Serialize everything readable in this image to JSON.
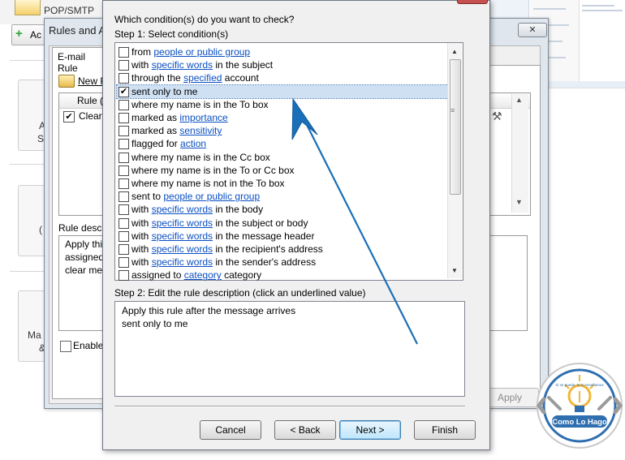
{
  "background": {
    "account_label": "POP/SMTP",
    "add_label": "Ac",
    "side_texts": [
      "A",
      "S",
      "(",
      "Ma",
      "&"
    ]
  },
  "rules_alerts": {
    "title": "Rules and A",
    "tab_label": "E-mail Rule",
    "new_label": "New R",
    "column_label": "Rule (",
    "rule_row_label": "Clear",
    "rule_desc_label": "Rule descr",
    "rule_desc_lines": [
      "Apply thi",
      "assigned",
      "clear mes"
    ],
    "enable_label": "Enable",
    "apply_label": "Apply"
  },
  "wizard": {
    "question": "Which condition(s) do you want to check?",
    "step1_label": "Step 1: Select condition(s)",
    "conditions": [
      {
        "pre": "from ",
        "link": "people or public group",
        "post": "",
        "checked": false
      },
      {
        "pre": "with ",
        "link": "specific words",
        "post": " in the subject",
        "checked": false
      },
      {
        "pre": "through the ",
        "link": "specified",
        "post": " account",
        "checked": false
      },
      {
        "pre": "sent only to me",
        "link": "",
        "post": "",
        "checked": true
      },
      {
        "pre": "where my name is in the To box",
        "link": "",
        "post": "",
        "checked": false
      },
      {
        "pre": "marked as ",
        "link": "importance",
        "post": "",
        "checked": false
      },
      {
        "pre": "marked as ",
        "link": "sensitivity",
        "post": "",
        "checked": false
      },
      {
        "pre": "flagged for ",
        "link": "action",
        "post": "",
        "checked": false
      },
      {
        "pre": "where my name is in the Cc box",
        "link": "",
        "post": "",
        "checked": false
      },
      {
        "pre": "where my name is in the To or Cc box",
        "link": "",
        "post": "",
        "checked": false
      },
      {
        "pre": "where my name is not in the To box",
        "link": "",
        "post": "",
        "checked": false
      },
      {
        "pre": "sent to ",
        "link": "people or public group",
        "post": "",
        "checked": false
      },
      {
        "pre": "with ",
        "link": "specific words",
        "post": " in the body",
        "checked": false
      },
      {
        "pre": "with ",
        "link": "specific words",
        "post": " in the subject or body",
        "checked": false
      },
      {
        "pre": "with ",
        "link": "specific words",
        "post": " in the message header",
        "checked": false
      },
      {
        "pre": "with ",
        "link": "specific words",
        "post": " in the recipient's address",
        "checked": false
      },
      {
        "pre": "with ",
        "link": "specific words",
        "post": " in the sender's address",
        "checked": false
      },
      {
        "pre": "assigned to ",
        "link": "category",
        "post": " category",
        "checked": false
      }
    ],
    "step2_label": "Step 2: Edit the rule description (click an underlined value)",
    "description_lines": [
      "Apply this rule after the message arrives",
      "sent only to me"
    ],
    "buttons": {
      "cancel": "Cancel",
      "back": "< Back",
      "next": "Next >",
      "finish": "Finish"
    }
  },
  "watermark": {
    "brand": "Como Lo Hago",
    "tagline": "Si se puede, te lo enseñamos",
    "ring_color": "#2f6fb0"
  },
  "colors": {
    "link": "#0a4fc2",
    "arrow": "#1a6fb8",
    "selection": "#cfe0f3"
  }
}
